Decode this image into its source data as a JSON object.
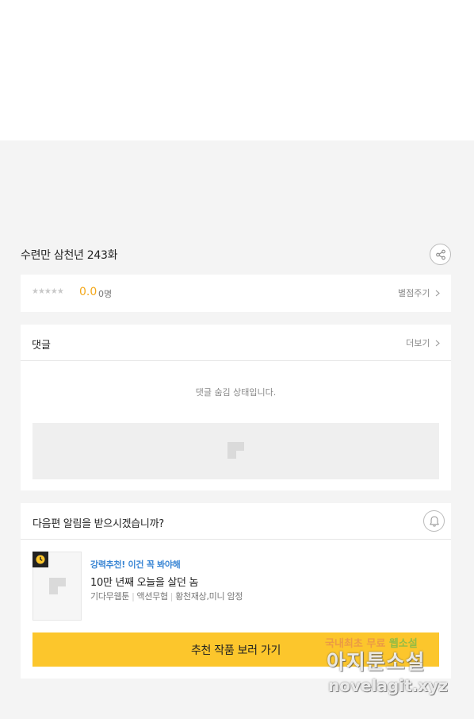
{
  "episode": {
    "title": "수련만 삼천년 243화"
  },
  "rating": {
    "stars": "★★★★★",
    "score": "0.0",
    "count": "0명",
    "rate_link": "별점주기"
  },
  "comments": {
    "title": "댓글",
    "more": "더보기",
    "hidden_message": "댓글 숨김 상태입니다."
  },
  "notify": {
    "question": "다음편 알림을 받으시겠습니까?",
    "recommend": {
      "promo": "강력추천! 이건 꼭 봐야해",
      "title": "10만 년째 오늘을 살던 놈",
      "meta": [
        "기다무웹툰",
        "액션무협",
        "황천재상,미니 암정"
      ],
      "button": "추천 작품 보러 가기"
    }
  },
  "watermark": {
    "line1a": "국내최초 무료",
    "line1b": "웹소설",
    "line2": "아지툰소설",
    "line3": "novelagit.xyz"
  },
  "icons": [
    "share-icon",
    "chevron-right-icon",
    "bell-icon",
    "clock-icon",
    "placeholder-logo-icon"
  ]
}
